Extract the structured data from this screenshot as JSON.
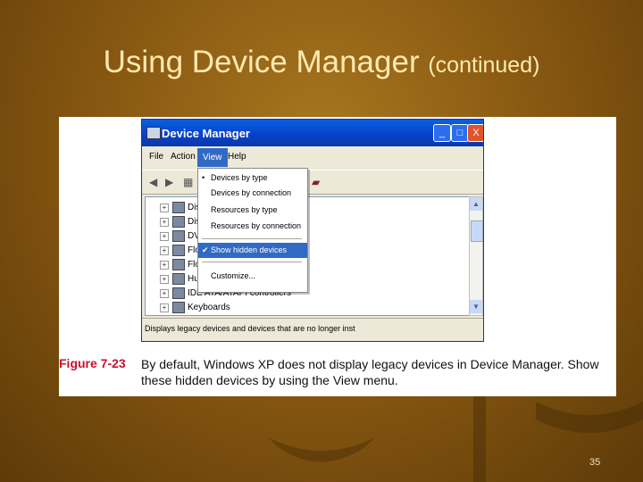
{
  "slide": {
    "title_main": "Using Device Manager",
    "title_sub": "(continued)",
    "page_number": "35"
  },
  "window": {
    "title": "Device Manager",
    "controls": {
      "minimize": "_",
      "maximize": "□",
      "close": "X"
    },
    "menu": [
      "File",
      "Action",
      "View",
      "Help"
    ],
    "status_text": "Displays legacy devices and devices that are no longer inst"
  },
  "view_menu": {
    "items": [
      {
        "label": "Devices by type",
        "mark": "•"
      },
      {
        "label": "Devices by connection",
        "mark": ""
      },
      {
        "label": "Resources by type",
        "mark": ""
      },
      {
        "label": "Resources by connection",
        "mark": ""
      },
      {
        "label": "Show hidden devices",
        "mark": "✔",
        "highlighted": true
      },
      {
        "label": "Customize...",
        "mark": ""
      }
    ]
  },
  "tree": {
    "rows": [
      "Disc",
      "Disp",
      "DVD",
      "Flop",
      "Flop",
      "Hum",
      "IDE ATA/ATAPI controllers",
      "Keyboards"
    ]
  },
  "figure": {
    "label": "Figure 7-23",
    "caption": "By default, Windows XP does not display legacy devices in Device Manager. Show these hidden devices by using the View menu."
  }
}
